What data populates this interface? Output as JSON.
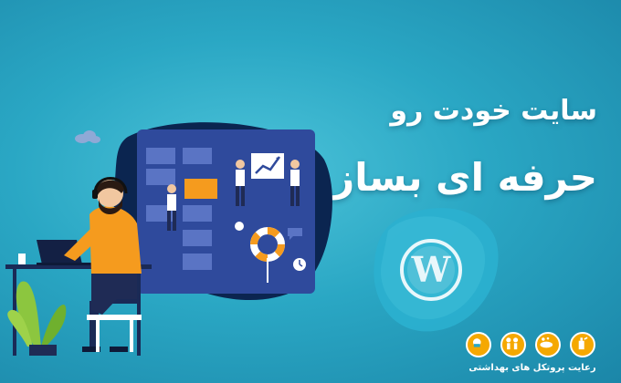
{
  "headline": {
    "line1": "سایت خودت رو",
    "line2": "حرفه ای بساز"
  },
  "badge": {
    "caption": "رعایت پروتکل های بهداشتی",
    "icons": [
      "mask-icon",
      "distance-icon",
      "hand-wash-icon",
      "sanitizer-spray-icon"
    ]
  },
  "colors": {
    "background": "#2aa7c4",
    "panel": "#2f4a9c",
    "accent": "#f59b1e",
    "wordpress": "#2bb0cf"
  },
  "logo": "wordpress-logo"
}
